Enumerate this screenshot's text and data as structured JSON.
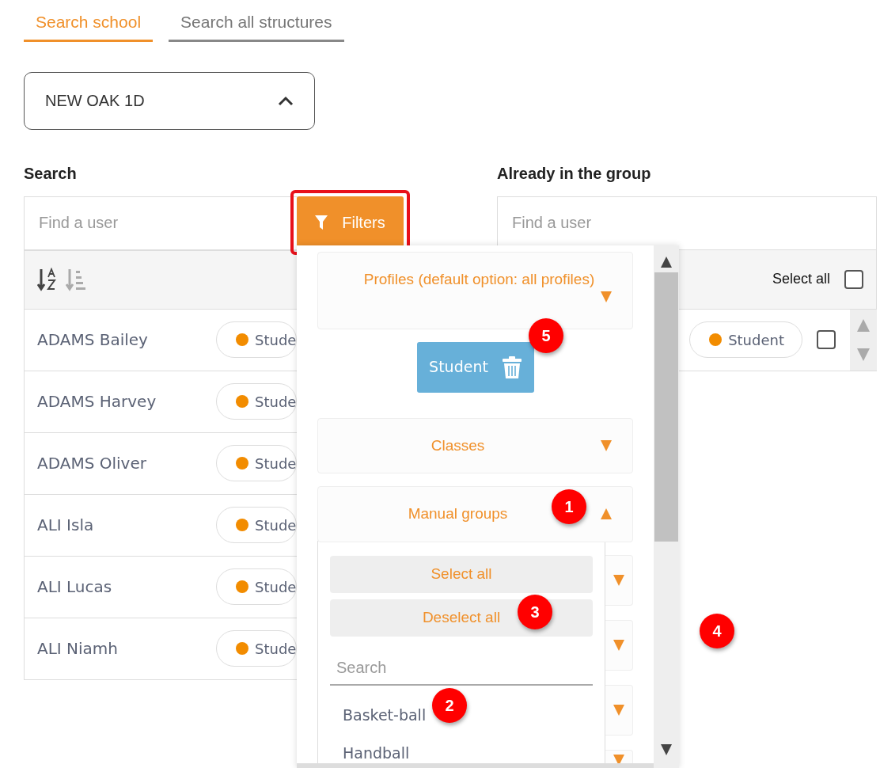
{
  "tabs": [
    {
      "label": "Search school",
      "selected": true
    },
    {
      "label": "Search all structures",
      "selected": false
    }
  ],
  "school_select": {
    "value": "NEW OAK 1D",
    "expanded": true
  },
  "search_panel": {
    "title": "Search",
    "search": {
      "placeholder": "Find a user"
    },
    "filters_button": {
      "label": "Filters",
      "highlighted": true
    },
    "users": [
      {
        "name": "ADAMS Bailey",
        "profile": "Stude"
      },
      {
        "name": "ADAMS Harvey",
        "profile": "Stude"
      },
      {
        "name": "ADAMS Oliver",
        "profile": "Stude"
      },
      {
        "name": "ALI Isla",
        "profile": "Stude"
      },
      {
        "name": "ALI Lucas",
        "profile": "Stude"
      },
      {
        "name": "ALI Niamh",
        "profile": "Stude"
      }
    ]
  },
  "group_panel": {
    "title": "Already in the group",
    "search": {
      "placeholder": "Find a user"
    },
    "select_all": {
      "label": "Select all",
      "checked": false
    },
    "members": [
      {
        "profile": "Student",
        "checked": false
      }
    ]
  },
  "filters_dropdown": {
    "sections": [
      {
        "label": "Profiles (default option: all profiles)",
        "expanded": false,
        "chips": [
          {
            "label": "Student"
          }
        ]
      },
      {
        "label": "Classes",
        "expanded": false
      },
      {
        "label": "Manual groups",
        "expanded": true,
        "select_all": "Select all",
        "deselect_all": "Deselect all",
        "search": {
          "placeholder": "Search"
        },
        "items": [
          "Basket-ball",
          "Handball"
        ]
      },
      {
        "expanded": false
      },
      {
        "expanded": false
      },
      {
        "expanded": false
      },
      {
        "expanded": false
      }
    ]
  },
  "annotations": [
    {
      "number": "1"
    },
    {
      "number": "2"
    },
    {
      "number": "3"
    },
    {
      "number": "4"
    },
    {
      "number": "5"
    }
  ]
}
